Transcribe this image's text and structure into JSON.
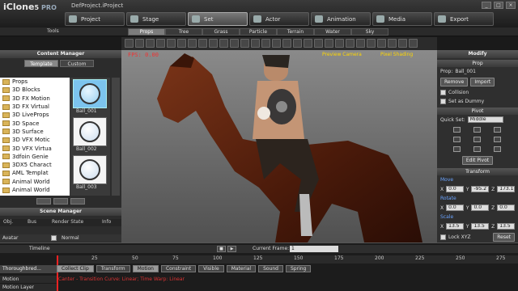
{
  "app": {
    "logo": "iClone",
    "logo_ver": "5",
    "logo_pro": "PRO",
    "project_title": "DefProject.iProject"
  },
  "window_buttons": [
    "_",
    "□",
    "×"
  ],
  "main_tabs": [
    {
      "label": "Project",
      "icon": "folder-icon"
    },
    {
      "label": "Stage",
      "icon": "stage-icon"
    },
    {
      "label": "Set",
      "icon": "set-icon",
      "active": true
    },
    {
      "label": "Actor",
      "icon": "actor-icon"
    },
    {
      "label": "Animation",
      "icon": "animation-icon"
    },
    {
      "label": "Media",
      "icon": "media-icon"
    },
    {
      "label": "Export",
      "icon": "export-icon"
    }
  ],
  "tools_label": "Tools",
  "sub_tabs": [
    {
      "label": "Props",
      "active": true
    },
    {
      "label": "Tree"
    },
    {
      "label": "Grass"
    },
    {
      "label": "Particle"
    },
    {
      "label": "Terrain"
    },
    {
      "label": "Water"
    },
    {
      "label": "Sky"
    }
  ],
  "content_manager": {
    "title": "Content Manager",
    "tabs": [
      {
        "label": "Template",
        "active": true
      },
      {
        "label": "Custom"
      }
    ],
    "tree": [
      "Props",
      "3D Blocks",
      "3D FX Motion",
      "3D FX Virtual",
      "3D LiveProps",
      "3D Space",
      "3D Surface",
      "3D VFX Motic",
      "3D VFX Virtua",
      "3dfoin Genie",
      "3DX5 Charact",
      "AML Templat",
      "Animal World",
      "Animal World"
    ],
    "thumbs": [
      {
        "label": "Ball_001",
        "selected": true
      },
      {
        "label": "Ball_002"
      },
      {
        "label": "Ball_003"
      }
    ]
  },
  "scene_manager": {
    "title": "Scene Manager",
    "columns": [
      "Obj.",
      "Bus",
      "Render State",
      "Info"
    ],
    "row": {
      "name": "Avatar",
      "state": "Normal"
    }
  },
  "viewport": {
    "fps": "FPS: 0.00",
    "camera": "Preview Camera",
    "shading": "Pixel Shading"
  },
  "modify": {
    "title": "Modify",
    "prop_section": "Prop",
    "prop_label": "Prop:",
    "prop_name": "Ball_001",
    "remove": "Remove",
    "import": "Import",
    "collision": "Collision",
    "set_dummy": "Set as Dummy",
    "pivot_section": "Pivot",
    "quick_set_label": "Quick Set:",
    "quick_set_value": "Middle",
    "edit_pivot": "Edit Pivot",
    "transform_section": "Transform",
    "move_label": "Move",
    "move": {
      "x": "0.0",
      "y": "-95.2",
      "z": "173.1"
    },
    "rotate_label": "Rotate",
    "rotate": {
      "x": "0.0",
      "y": "0.0",
      "z": "0.0"
    },
    "scale_label": "Scale",
    "scale": {
      "x": "13.5",
      "y": "13.5",
      "z": "13.5"
    },
    "lock_xyz": "Lock XYZ",
    "reset": "Reset"
  },
  "timeline": {
    "title": "Timeline",
    "current_frame_label": "Current Frame:",
    "current_frame": "1",
    "ruler": [
      "25",
      "50",
      "75",
      "100",
      "125",
      "150",
      "175",
      "200",
      "225",
      "250",
      "275"
    ],
    "track_name": "Thoroughbred...",
    "clip_buttons": [
      {
        "label": "Collect Clip",
        "active": true
      },
      {
        "label": "Transform"
      },
      {
        "label": "Motion",
        "active": true
      },
      {
        "label": "Constraint"
      },
      {
        "label": "Visible"
      },
      {
        "label": "Material"
      },
      {
        "label": "Sound"
      },
      {
        "label": "Spring"
      }
    ],
    "motion_label": "Motion",
    "motion_info": "Canter - Transition Curve: Linear; Time Warp: Linear",
    "motion_layer_label": "Motion Layer"
  }
}
